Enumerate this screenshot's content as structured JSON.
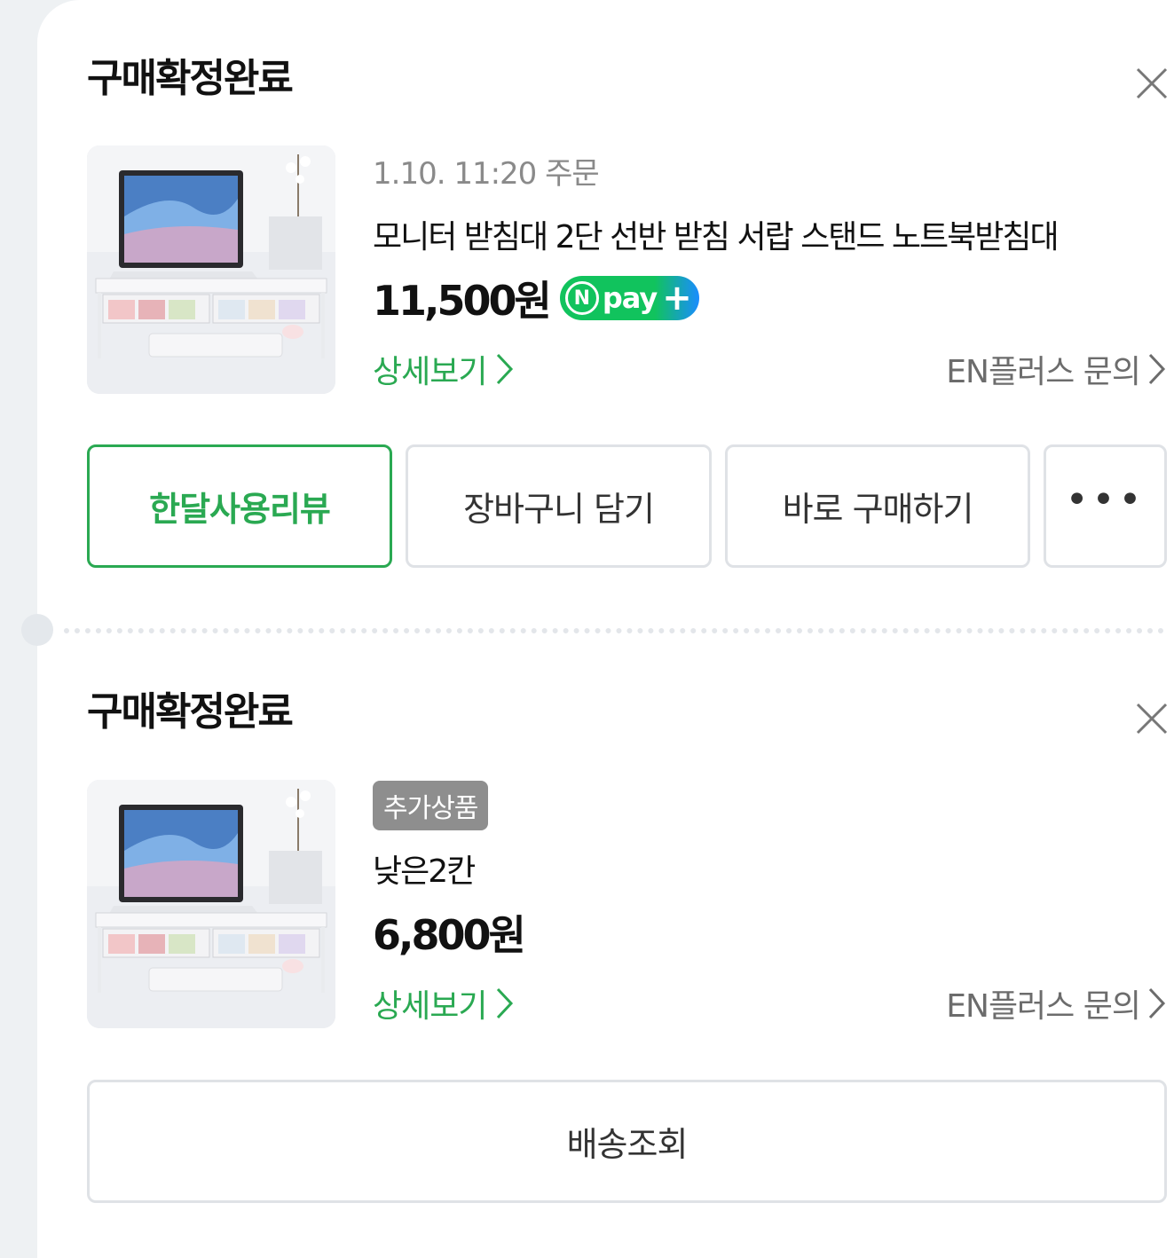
{
  "orders": [
    {
      "status": "구매확정완료",
      "order_time": "1.10. 11:20 주문",
      "product_name": "모니터 받침대 2단 선반 받침 서랍 스탠드 노트북받침대",
      "price": "11,500원",
      "npay": {
        "n": "N",
        "pay": "pay",
        "plus": "+"
      },
      "detail_link": "상세보기",
      "inquiry_link": "EN플러스 문의",
      "buttons": [
        "한달사용리뷰",
        "장바구니 담기",
        "바로 구매하기",
        "•••"
      ]
    },
    {
      "status": "구매확정완료",
      "badge": "추가상품",
      "product_name": "낮은2칸",
      "price": "6,800원",
      "detail_link": "상세보기",
      "inquiry_link": "EN플러스 문의",
      "button": "배송조회"
    }
  ],
  "colors": {
    "accent_green": "#2aa952",
    "npay_green": "#11c35d",
    "npay_blue": "#1a8cff"
  },
  "icons": {
    "close": "close-icon",
    "chevron": "chevron-right-icon",
    "more": "more-dots-icon"
  }
}
